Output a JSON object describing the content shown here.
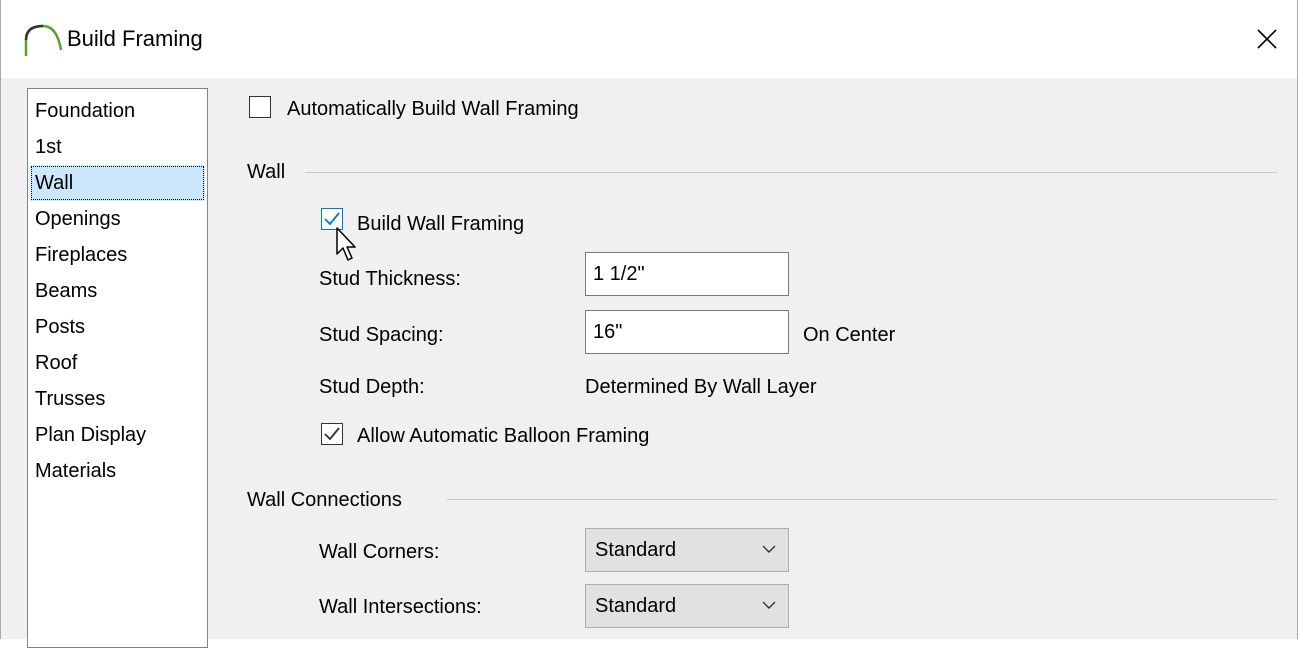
{
  "window": {
    "title": "Build Framing",
    "icon": "arch-icon",
    "close_glyph": "✕"
  },
  "sidebar": {
    "items": [
      {
        "label": "Foundation",
        "selected": false
      },
      {
        "label": "1st",
        "selected": false
      },
      {
        "label": "Wall",
        "selected": true
      },
      {
        "label": "Openings",
        "selected": false
      },
      {
        "label": "Fireplaces",
        "selected": false
      },
      {
        "label": "Beams",
        "selected": false
      },
      {
        "label": "Posts",
        "selected": false
      },
      {
        "label": "Roof",
        "selected": false
      },
      {
        "label": "Trusses",
        "selected": false
      },
      {
        "label": "Plan Display",
        "selected": false
      },
      {
        "label": "Materials",
        "selected": false
      }
    ]
  },
  "panel": {
    "auto_build": {
      "label": "Automatically Build Wall Framing",
      "checked": false
    },
    "wall_group": {
      "title": "Wall",
      "build_wall_framing": {
        "label": "Build Wall Framing",
        "checked": true
      },
      "stud_thickness": {
        "label": "Stud Thickness:",
        "value": "1 1/2\""
      },
      "stud_spacing": {
        "label": "Stud Spacing:",
        "value": "16\"",
        "suffix": "On Center"
      },
      "stud_depth": {
        "label": "Stud Depth:",
        "value": "Determined By Wall Layer"
      },
      "balloon_framing": {
        "label": "Allow Automatic Balloon Framing",
        "checked": true
      }
    },
    "connections_group": {
      "title": "Wall Connections",
      "wall_corners": {
        "label": "Wall Corners:",
        "value": "Standard"
      },
      "wall_intersections": {
        "label": "Wall Intersections:",
        "value": "Standard"
      }
    }
  },
  "colors": {
    "selection": "#cce8ff",
    "accent": "#0078d7",
    "dialog_bg": "#f0f0f0"
  }
}
